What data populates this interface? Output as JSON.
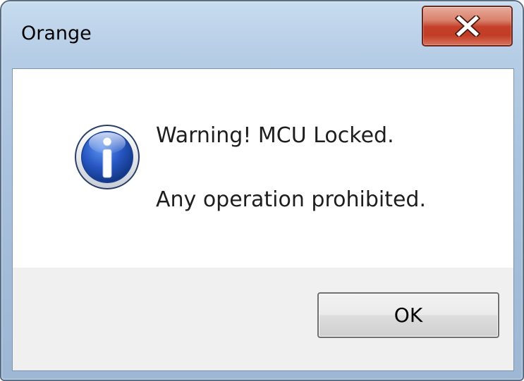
{
  "window": {
    "title": "Orange"
  },
  "titlebar": {
    "close_icon": "close-x-icon",
    "close_color": "#c7412b"
  },
  "dialog": {
    "icon": "information-icon",
    "icon_color": "#1f4fb8",
    "message_line_1": "Warning! MCU Locked.",
    "message_line_2": "Any operation prohibited.",
    "ok_label": "OK"
  }
}
